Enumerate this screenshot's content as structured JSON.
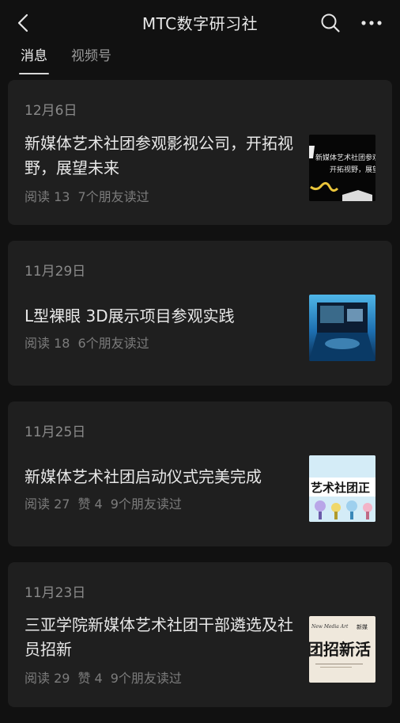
{
  "header": {
    "title": "MTC数字研习社"
  },
  "tabs": [
    {
      "label": "消息",
      "active": true
    },
    {
      "label": "视频号",
      "active": false
    }
  ],
  "articles": [
    {
      "date": "12月6日",
      "title": "新媒体艺术社团参观影视公司，开拓视野，展望未来",
      "reads": "阅读 13",
      "likes": "",
      "friends": "7个朋友读过",
      "thumb_text_1": "新媒体艺术社团参观",
      "thumb_text_2": "开拓视野，展望"
    },
    {
      "date": "11月29日",
      "title": "L型裸眼 3D展示项目参观实践",
      "reads": "阅读 18",
      "likes": "",
      "friends": "6个朋友读过"
    },
    {
      "date": "11月25日",
      "title": "新媒体艺术社团启动仪式完美完成",
      "reads": "阅读 27",
      "likes": "赞 4",
      "friends": "9个朋友读过",
      "thumb_text_1": "艺术社团正"
    },
    {
      "date": "11月23日",
      "title": "三亚学院新媒体艺术社团干部遴选及社员招新",
      "reads": "阅读 29",
      "likes": "赞 4",
      "friends": "9个朋友读过",
      "thumb_text_1": "团招新活",
      "thumb_text_2": "New Media Art",
      "thumb_text_3": "新媒"
    }
  ],
  "colors": {
    "background": "#111111",
    "card": "#1f1f1f",
    "text_primary": "#e8e8e8",
    "text_secondary": "#8a8a8a"
  }
}
